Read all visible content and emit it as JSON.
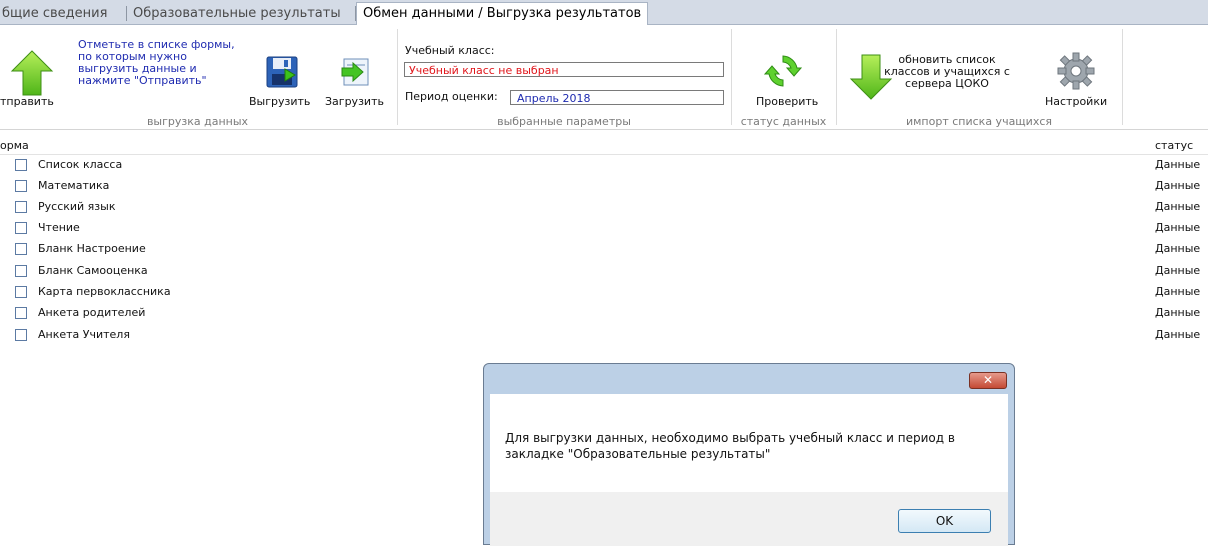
{
  "tabs": [
    {
      "label": "бщие сведения"
    },
    {
      "label": "Образовательные результаты"
    },
    {
      "label": "Обмен данными / Выгрузка результатов"
    }
  ],
  "ribbon": {
    "export": {
      "send_label": "тправить",
      "hint": "Отметьте в списке формы, по которым нужно выгрузить данные и нажмите \"Отправить\"",
      "unload_label": "Выгрузить",
      "load_label": "Загрузить",
      "group_label": "выгрузка данных"
    },
    "params": {
      "class_label": "Учебный класс:",
      "class_value": "Учебный класс не выбран",
      "period_label": "Период оценки:",
      "period_value": "Апрель 2018",
      "group_label": "выбранные параметры"
    },
    "status": {
      "check_label": "Проверить",
      "group_label": "статус данных"
    },
    "import": {
      "update_text": "обновить список классов и учащихся с сервера ЦОКО",
      "settings_label": "Настройки",
      "group_label": "импорт списка учащихся"
    }
  },
  "list": {
    "columns": {
      "form": "орма",
      "status": "статус"
    },
    "rows": [
      {
        "label": "Список класса",
        "status": "Данные"
      },
      {
        "label": "Математика",
        "status": "Данные"
      },
      {
        "label": "Русский язык",
        "status": "Данные"
      },
      {
        "label": "Чтение",
        "status": "Данные"
      },
      {
        "label": "Бланк Настроение",
        "status": "Данные"
      },
      {
        "label": "Бланк Самооценка",
        "status": "Данные"
      },
      {
        "label": "Карта первоклассника",
        "status": "Данные"
      },
      {
        "label": "Анкета родителей",
        "status": "Данные"
      },
      {
        "label": "Анкета Учителя",
        "status": "Данные"
      }
    ]
  },
  "dialog": {
    "message": "Для выгрузки данных, необходимо выбрать учебный класс и период в закладке \"Образовательные результаты\"",
    "ok_label": "OK",
    "close_glyph": "✕"
  },
  "colors": {
    "warning_text": "#e0151a",
    "period_text": "#1f2bb0",
    "hint_text": "#1f2bb0"
  },
  "icons": {
    "send": "green-up-arrow-icon",
    "unload": "floppy-disk-icon",
    "load": "arrow-into-box-icon",
    "check": "refresh-arrows-icon",
    "update": "green-down-arrow-icon",
    "settings": "gear-icon"
  }
}
